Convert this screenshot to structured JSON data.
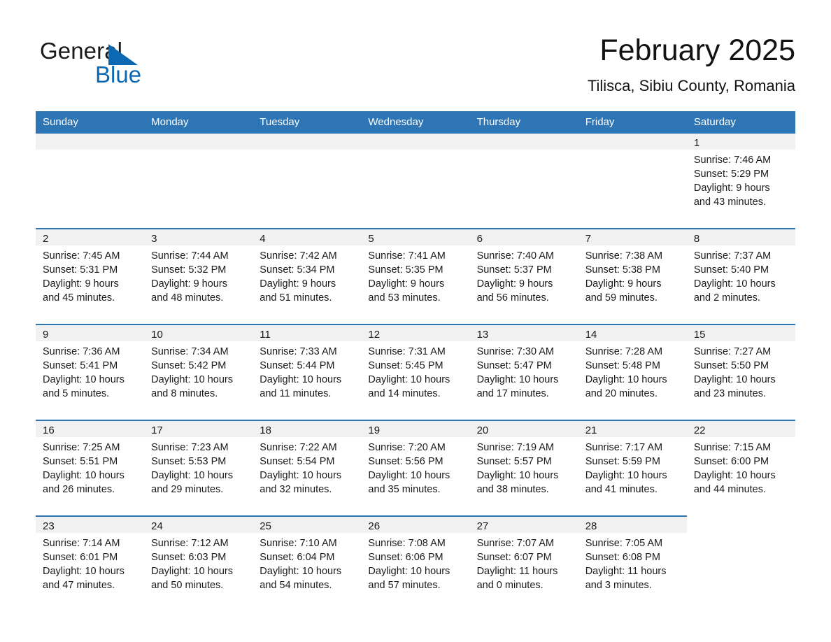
{
  "logo": {
    "text_top": "General",
    "text_bottom": "Blue",
    "triangle_color": "#0b68b3"
  },
  "header": {
    "title": "February 2025",
    "subtitle": "Tilisca, Sibiu County, Romania"
  },
  "theme": {
    "header_blue": "#2e75b6",
    "band_gray": "#f1f1f1",
    "text": "#1a1a1a"
  },
  "calendar": {
    "weekday_headers": [
      "Sunday",
      "Monday",
      "Tuesday",
      "Wednesday",
      "Thursday",
      "Friday",
      "Saturday"
    ],
    "weeks": [
      [
        {
          "day": "",
          "empty": true
        },
        {
          "day": "",
          "empty": true
        },
        {
          "day": "",
          "empty": true
        },
        {
          "day": "",
          "empty": true
        },
        {
          "day": "",
          "empty": true
        },
        {
          "day": "",
          "empty": true
        },
        {
          "day": "1",
          "sunrise": "Sunrise: 7:46 AM",
          "sunset": "Sunset: 5:29 PM",
          "daylight1": "Daylight: 9 hours",
          "daylight2": "and 43 minutes."
        }
      ],
      [
        {
          "day": "2",
          "sunrise": "Sunrise: 7:45 AM",
          "sunset": "Sunset: 5:31 PM",
          "daylight1": "Daylight: 9 hours",
          "daylight2": "and 45 minutes."
        },
        {
          "day": "3",
          "sunrise": "Sunrise: 7:44 AM",
          "sunset": "Sunset: 5:32 PM",
          "daylight1": "Daylight: 9 hours",
          "daylight2": "and 48 minutes."
        },
        {
          "day": "4",
          "sunrise": "Sunrise: 7:42 AM",
          "sunset": "Sunset: 5:34 PM",
          "daylight1": "Daylight: 9 hours",
          "daylight2": "and 51 minutes."
        },
        {
          "day": "5",
          "sunrise": "Sunrise: 7:41 AM",
          "sunset": "Sunset: 5:35 PM",
          "daylight1": "Daylight: 9 hours",
          "daylight2": "and 53 minutes."
        },
        {
          "day": "6",
          "sunrise": "Sunrise: 7:40 AM",
          "sunset": "Sunset: 5:37 PM",
          "daylight1": "Daylight: 9 hours",
          "daylight2": "and 56 minutes."
        },
        {
          "day": "7",
          "sunrise": "Sunrise: 7:38 AM",
          "sunset": "Sunset: 5:38 PM",
          "daylight1": "Daylight: 9 hours",
          "daylight2": "and 59 minutes."
        },
        {
          "day": "8",
          "sunrise": "Sunrise: 7:37 AM",
          "sunset": "Sunset: 5:40 PM",
          "daylight1": "Daylight: 10 hours",
          "daylight2": "and 2 minutes."
        }
      ],
      [
        {
          "day": "9",
          "sunrise": "Sunrise: 7:36 AM",
          "sunset": "Sunset: 5:41 PM",
          "daylight1": "Daylight: 10 hours",
          "daylight2": "and 5 minutes."
        },
        {
          "day": "10",
          "sunrise": "Sunrise: 7:34 AM",
          "sunset": "Sunset: 5:42 PM",
          "daylight1": "Daylight: 10 hours",
          "daylight2": "and 8 minutes."
        },
        {
          "day": "11",
          "sunrise": "Sunrise: 7:33 AM",
          "sunset": "Sunset: 5:44 PM",
          "daylight1": "Daylight: 10 hours",
          "daylight2": "and 11 minutes."
        },
        {
          "day": "12",
          "sunrise": "Sunrise: 7:31 AM",
          "sunset": "Sunset: 5:45 PM",
          "daylight1": "Daylight: 10 hours",
          "daylight2": "and 14 minutes."
        },
        {
          "day": "13",
          "sunrise": "Sunrise: 7:30 AM",
          "sunset": "Sunset: 5:47 PM",
          "daylight1": "Daylight: 10 hours",
          "daylight2": "and 17 minutes."
        },
        {
          "day": "14",
          "sunrise": "Sunrise: 7:28 AM",
          "sunset": "Sunset: 5:48 PM",
          "daylight1": "Daylight: 10 hours",
          "daylight2": "and 20 minutes."
        },
        {
          "day": "15",
          "sunrise": "Sunrise: 7:27 AM",
          "sunset": "Sunset: 5:50 PM",
          "daylight1": "Daylight: 10 hours",
          "daylight2": "and 23 minutes."
        }
      ],
      [
        {
          "day": "16",
          "sunrise": "Sunrise: 7:25 AM",
          "sunset": "Sunset: 5:51 PM",
          "daylight1": "Daylight: 10 hours",
          "daylight2": "and 26 minutes."
        },
        {
          "day": "17",
          "sunrise": "Sunrise: 7:23 AM",
          "sunset": "Sunset: 5:53 PM",
          "daylight1": "Daylight: 10 hours",
          "daylight2": "and 29 minutes."
        },
        {
          "day": "18",
          "sunrise": "Sunrise: 7:22 AM",
          "sunset": "Sunset: 5:54 PM",
          "daylight1": "Daylight: 10 hours",
          "daylight2": "and 32 minutes."
        },
        {
          "day": "19",
          "sunrise": "Sunrise: 7:20 AM",
          "sunset": "Sunset: 5:56 PM",
          "daylight1": "Daylight: 10 hours",
          "daylight2": "and 35 minutes."
        },
        {
          "day": "20",
          "sunrise": "Sunrise: 7:19 AM",
          "sunset": "Sunset: 5:57 PM",
          "daylight1": "Daylight: 10 hours",
          "daylight2": "and 38 minutes."
        },
        {
          "day": "21",
          "sunrise": "Sunrise: 7:17 AM",
          "sunset": "Sunset: 5:59 PM",
          "daylight1": "Daylight: 10 hours",
          "daylight2": "and 41 minutes."
        },
        {
          "day": "22",
          "sunrise": "Sunrise: 7:15 AM",
          "sunset": "Sunset: 6:00 PM",
          "daylight1": "Daylight: 10 hours",
          "daylight2": "and 44 minutes."
        }
      ],
      [
        {
          "day": "23",
          "sunrise": "Sunrise: 7:14 AM",
          "sunset": "Sunset: 6:01 PM",
          "daylight1": "Daylight: 10 hours",
          "daylight2": "and 47 minutes."
        },
        {
          "day": "24",
          "sunrise": "Sunrise: 7:12 AM",
          "sunset": "Sunset: 6:03 PM",
          "daylight1": "Daylight: 10 hours",
          "daylight2": "and 50 minutes."
        },
        {
          "day": "25",
          "sunrise": "Sunrise: 7:10 AM",
          "sunset": "Sunset: 6:04 PM",
          "daylight1": "Daylight: 10 hours",
          "daylight2": "and 54 minutes."
        },
        {
          "day": "26",
          "sunrise": "Sunrise: 7:08 AM",
          "sunset": "Sunset: 6:06 PM",
          "daylight1": "Daylight: 10 hours",
          "daylight2": "and 57 minutes."
        },
        {
          "day": "27",
          "sunrise": "Sunrise: 7:07 AM",
          "sunset": "Sunset: 6:07 PM",
          "daylight1": "Daylight: 11 hours",
          "daylight2": "and 0 minutes."
        },
        {
          "day": "28",
          "sunrise": "Sunrise: 7:05 AM",
          "sunset": "Sunset: 6:08 PM",
          "daylight1": "Daylight: 11 hours",
          "daylight2": "and 3 minutes."
        },
        {
          "day": "",
          "empty": true,
          "trailing": true
        }
      ]
    ]
  }
}
